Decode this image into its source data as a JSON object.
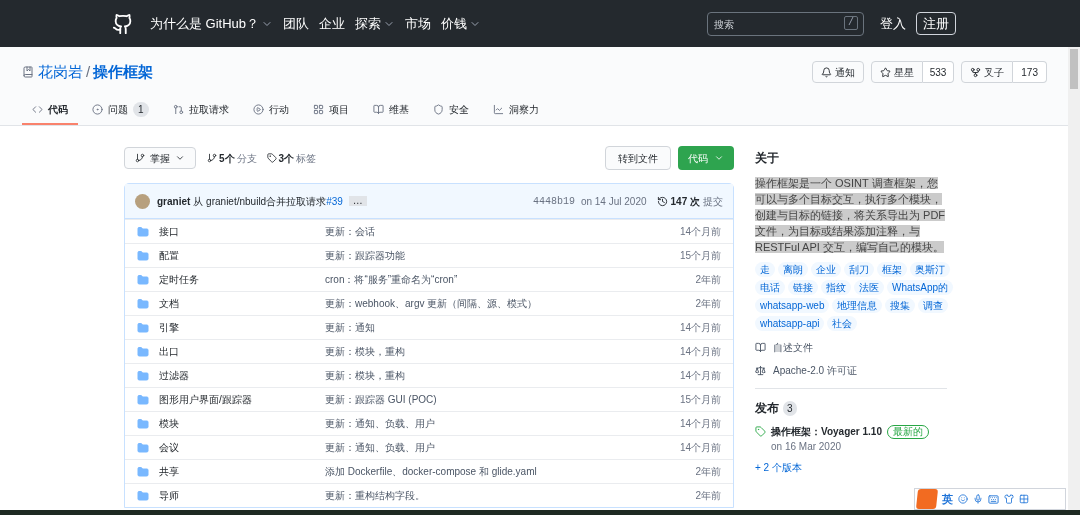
{
  "nav": {
    "items": [
      {
        "label": "为什么是 GitHub？",
        "dropdown": true
      },
      {
        "label": "团队",
        "dropdown": false
      },
      {
        "label": "企业",
        "dropdown": false
      },
      {
        "label": "探索",
        "dropdown": true
      },
      {
        "label": "市场",
        "dropdown": false
      },
      {
        "label": "价钱",
        "dropdown": true
      }
    ],
    "search": {
      "placeholder": "搜索",
      "key": "/"
    },
    "sign_in": "登入",
    "sign_up": "注册"
  },
  "repo": {
    "owner": "花岗岩",
    "separator": "/",
    "name": "操作框架",
    "watch": "通知",
    "star": {
      "label": "星星",
      "count": "533"
    },
    "fork": {
      "label": "叉子",
      "count": "173"
    }
  },
  "tabs": [
    {
      "label": "代码",
      "selected": true
    },
    {
      "label": "问题",
      "count": "1",
      "selected": false
    },
    {
      "label": "拉取请求",
      "selected": false
    },
    {
      "label": "行动",
      "selected": false
    },
    {
      "label": "项目",
      "selected": false
    },
    {
      "label": "维基",
      "selected": false
    },
    {
      "label": "安全",
      "selected": false
    },
    {
      "label": "洞察力",
      "selected": false
    }
  ],
  "toolbar": {
    "branch": "掌握",
    "branches": {
      "count": "5个",
      "label": "分支"
    },
    "tags": {
      "count": "3个",
      "label": "标签"
    },
    "go_to_file": "转到文件",
    "code": "代码"
  },
  "commit": {
    "author": "graniet",
    "message": "从 graniet/nbuild合并拉取请求",
    "link": "#39",
    "more": "…",
    "hash": "4448b19",
    "date": "on 14 Jul 2020",
    "count": "147 次",
    "count_label": "提交"
  },
  "files": [
    {
      "name": "接口",
      "message": "更新：会话",
      "age": "14个月前"
    },
    {
      "name": "配置",
      "message": "更新：跟踪器功能",
      "age": "15个月前"
    },
    {
      "name": "定时任务",
      "message": "cron：将“服务”重命名为“cron”",
      "age": "2年前"
    },
    {
      "name": "文档",
      "message": "更新：webhook、argv 更新（间隔、源、模式）",
      "age": "2年前"
    },
    {
      "name": "引擎",
      "message": "更新：通知",
      "age": "14个月前"
    },
    {
      "name": "出口",
      "message": "更新：模块，重构",
      "age": "14个月前"
    },
    {
      "name": "过滤器",
      "message": "更新：模块，重构",
      "age": "14个月前"
    },
    {
      "name": "图形用户界面/跟踪器",
      "message": "更新：跟踪器 GUI (POC)",
      "age": "15个月前"
    },
    {
      "name": "模块",
      "message": "更新：通知、负载、用户",
      "age": "14个月前"
    },
    {
      "name": "会议",
      "message": "更新：通知、负载、用户",
      "age": "14个月前"
    },
    {
      "name": "共享",
      "message": "添加 Dockerfile、docker-compose 和 glide.yaml",
      "age": "2年前"
    },
    {
      "name": "导师",
      "message": "更新：重构结构字段。",
      "age": "2年前"
    }
  ],
  "about": {
    "title": "关于",
    "description": "操作框架是一个 OSINT 调查框架，您可以与多个目标交互，执行多个模块，创建与目标的链接，将关系导出为 PDF 文件，为目标或结果添加注释，与 RESTFul API 交互，编写自己的模块。",
    "topics": [
      "走",
      "离朗",
      "企业",
      "刮刀",
      "框架",
      "奥斯汀",
      "电话",
      "链接",
      "指纹",
      "法医",
      "WhatsApp的",
      "whatsapp-web",
      "地理信息",
      "搜集",
      "调查",
      "whatsapp-api",
      "社会"
    ],
    "readme": "自述文件",
    "license": "Apache-2.0 许可证"
  },
  "releases": {
    "title": "发布",
    "count": "3",
    "latest": {
      "name": "操作框架：Voyager 1.10",
      "badge": "最新的",
      "date": "on 16 Mar 2020"
    },
    "more": "+ 2 个版本"
  },
  "ime": {
    "label": "英"
  }
}
